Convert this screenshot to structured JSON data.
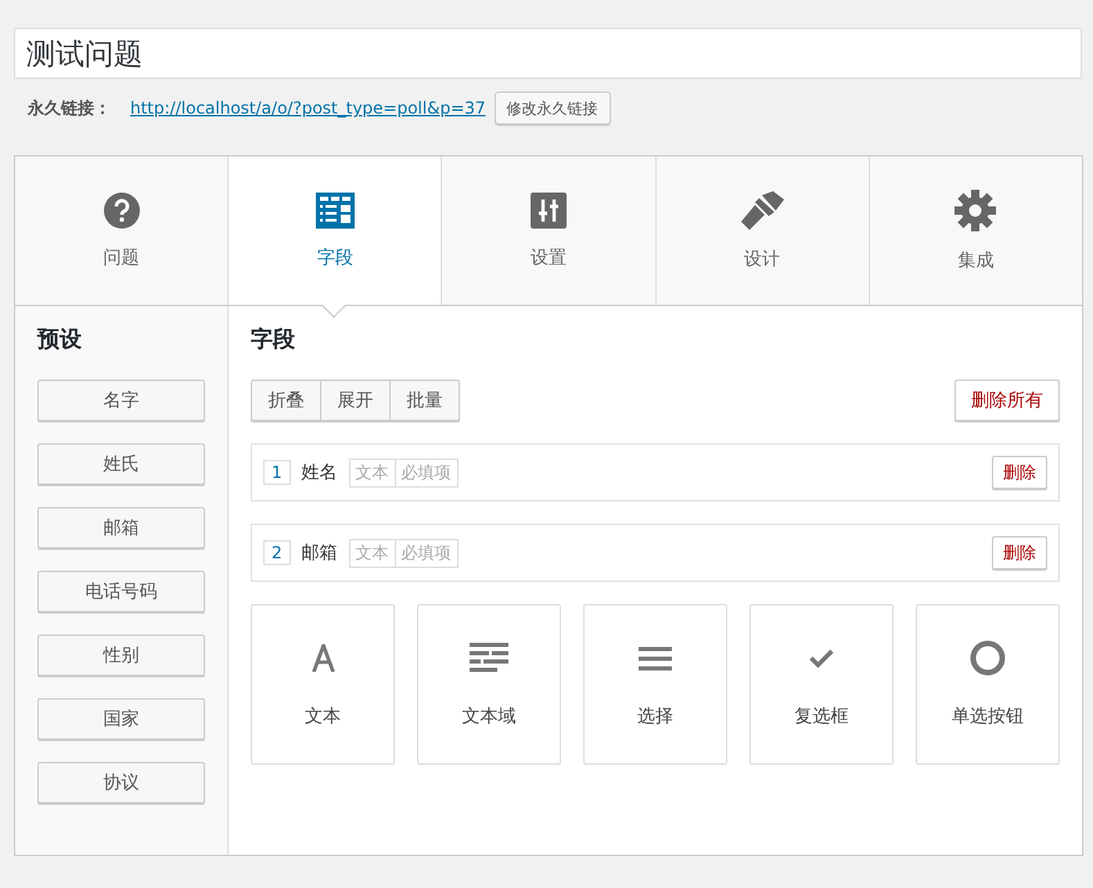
{
  "title": {
    "value": "测试问题"
  },
  "permalink": {
    "label": "永久链接：",
    "url": "http://localhost/a/o/?post_type=poll&p=37",
    "button": "修改永久链接"
  },
  "tabs": [
    {
      "label": "问题",
      "selected": false
    },
    {
      "label": "字段",
      "selected": true
    },
    {
      "label": "设置",
      "selected": false
    },
    {
      "label": "设计",
      "selected": false
    },
    {
      "label": "集成",
      "selected": false
    }
  ],
  "presets": {
    "heading": "预设",
    "items": [
      "名字",
      "姓氏",
      "邮箱",
      "电话号码",
      "性别",
      "国家",
      "协议"
    ]
  },
  "fields": {
    "heading": "字段",
    "actions": [
      "折叠",
      "展开",
      "批量"
    ],
    "delete_all": "删除所有",
    "rows": [
      {
        "number": "1",
        "name": "姓名",
        "type": "文本",
        "required": "必填项",
        "delete": "删除"
      },
      {
        "number": "2",
        "name": "邮箱",
        "type": "文本",
        "required": "必填项",
        "delete": "删除"
      }
    ],
    "types": [
      "文本",
      "文本域",
      "选择",
      "复选框",
      "单选按钮"
    ]
  }
}
